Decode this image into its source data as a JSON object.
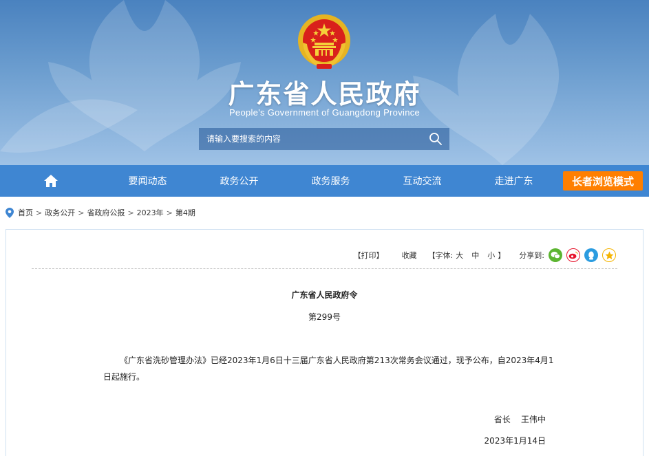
{
  "header": {
    "title": "广东省人民政府",
    "subtitle": "People's Government of Guangdong Province",
    "search_placeholder": "请输入要搜索的内容"
  },
  "nav": {
    "items": [
      "要闻动态",
      "政务公开",
      "政务服务",
      "互动交流",
      "走进广东"
    ],
    "elder_mode": "长者浏览模式"
  },
  "breadcrumb": {
    "items": [
      "首页",
      "政务公开",
      "省政府公报",
      "2023年",
      "第4期"
    ],
    "separator": ">"
  },
  "toolbar": {
    "print": "【打印】",
    "collect": "收藏",
    "font_prefix": "【字体:",
    "font_large": "大",
    "font_medium": "中",
    "font_small": "小",
    "font_suffix": "】",
    "share_label": "分享到:",
    "share_icons": [
      "wechat-icon",
      "weibo-icon",
      "qq-icon",
      "qzone-icon"
    ]
  },
  "document": {
    "title": "广东省人民政府令",
    "number": "第299号",
    "body": "《广东省洗砂管理办法》已经2023年1月6日十三届广东省人民政府第213次常务会议通过，现予公布，自2023年4月1日起施行。",
    "signature_role": "省长",
    "signature_name": "王伟中",
    "date": "2023年1月14日"
  },
  "colors": {
    "nav_bg": "#3f86d2",
    "elder_btn": "#ff7f00",
    "wechat": "#5cb531",
    "weibo": "#e6162d",
    "qq": "#2b9ce0",
    "qzone": "#f5b400"
  }
}
